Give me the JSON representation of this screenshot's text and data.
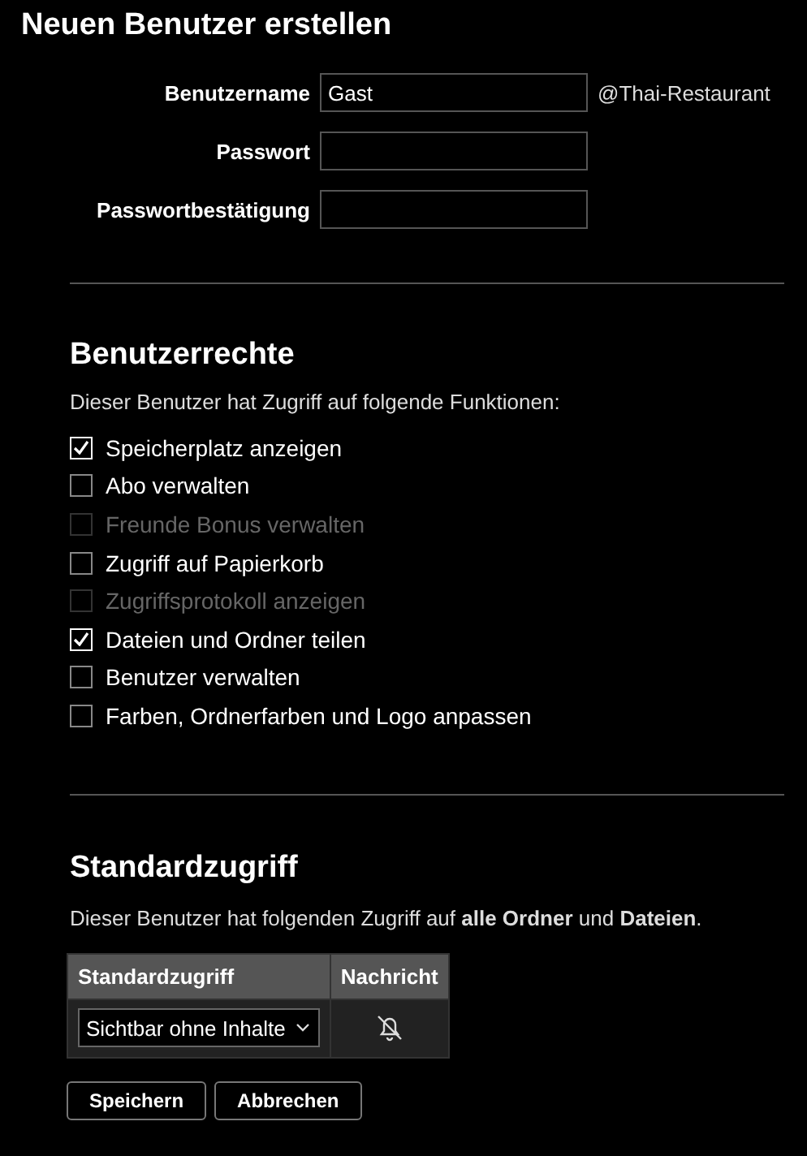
{
  "title": "Neuen Benutzer erstellen",
  "fields": [
    {
      "label": "Benutzername",
      "value": "Gast",
      "suffix": "@Thai-Restaurant"
    },
    {
      "label": "Passwort"
    },
    {
      "label": "Passwortbestätigung"
    }
  ],
  "permissions": {
    "heading": "Benutzerrechte",
    "description": "Dieser Benutzer hat Zugriff auf folgende Funktionen:",
    "items": [
      {
        "label": "Speicherplatz anzeigen",
        "checked": true,
        "disabled": false
      },
      {
        "label": "Abo verwalten",
        "checked": false,
        "disabled": false
      },
      {
        "label": "Freunde Bonus verwalten",
        "checked": false,
        "disabled": true
      },
      {
        "label": "Zugriff auf Papierkorb",
        "checked": false,
        "disabled": false
      },
      {
        "label": "Zugriffsprotokoll anzeigen",
        "checked": false,
        "disabled": true
      },
      {
        "label": "Dateien und Ordner teilen",
        "checked": true,
        "disabled": false
      },
      {
        "label": "Benutzer verwalten",
        "checked": false,
        "disabled": false
      },
      {
        "label": "Farben, Ordnerfarben und Logo anpassen",
        "checked": false,
        "disabled": false
      }
    ]
  },
  "default_access": {
    "heading": "Standardzugriff",
    "description": "Dieser Benutzer hat folgenden Zugriff auf **alle Ordner** und **Dateien**.",
    "table": {
      "columns": [
        "Standardzugriff",
        "Nachricht"
      ],
      "row": {
        "access": "Sichtbar ohne Inhalte",
        "notifications": false
      }
    }
  },
  "buttons": [
    "Speichern",
    "Abbrechen"
  ]
}
